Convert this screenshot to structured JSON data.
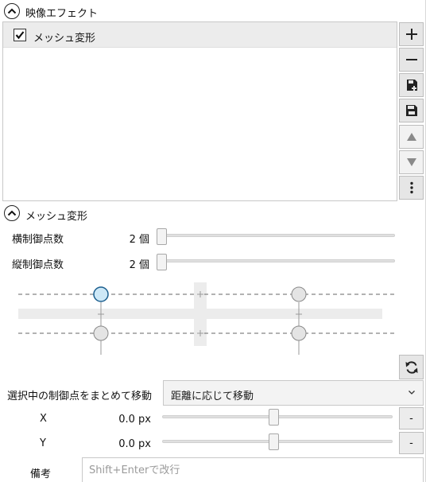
{
  "effects_header": {
    "title": "映像エフェクト",
    "collapse_icon": "chevron-up-icon"
  },
  "effect_list": {
    "items": [
      {
        "label": "メッシュ変形",
        "enabled": true
      }
    ]
  },
  "side_buttons": [
    {
      "name": "add-button",
      "icon": "plus-icon",
      "enabled": true
    },
    {
      "name": "remove-button",
      "icon": "minus-icon",
      "enabled": true
    },
    {
      "name": "save-as-preset-button",
      "icon": "save-plus-icon",
      "enabled": true
    },
    {
      "name": "save-button",
      "icon": "save-icon",
      "enabled": true
    },
    {
      "name": "move-up-button",
      "icon": "triangle-up-icon",
      "enabled": false
    },
    {
      "name": "move-down-button",
      "icon": "triangle-down-icon",
      "enabled": false
    },
    {
      "name": "more-button",
      "icon": "more-vertical-icon",
      "enabled": true
    }
  ],
  "mesh_section": {
    "title": "メッシュ変形",
    "collapse_icon": "chevron-up-icon",
    "horizontal_points": {
      "label": "横制御点数",
      "value": "2 個",
      "level": 0
    },
    "vertical_points": {
      "label": "縦制御点数",
      "value": "2 個",
      "level": 0
    },
    "selected_point": {
      "row": 0,
      "col": 0
    },
    "reset_icon": "refresh-icon"
  },
  "group_move": {
    "label": "選択中の制御点をまとめて移動",
    "selected": "距離に応じて移動",
    "chevron_icon": "chevron-down-icon"
  },
  "position": {
    "x": {
      "label": "X",
      "value": "0.0 px",
      "button": "-",
      "level": 0.5
    },
    "y": {
      "label": "Y",
      "value": "0.0 px",
      "button": "-",
      "level": 0.5
    }
  },
  "notes": {
    "label": "備考",
    "placeholder": "Shift+Enterで改行",
    "value": ""
  },
  "colors": {
    "accent": "#cde8f7",
    "accent_border": "#1c5f8f",
    "button_bg": "#e6e6e6",
    "border": "#c8c8c8"
  }
}
